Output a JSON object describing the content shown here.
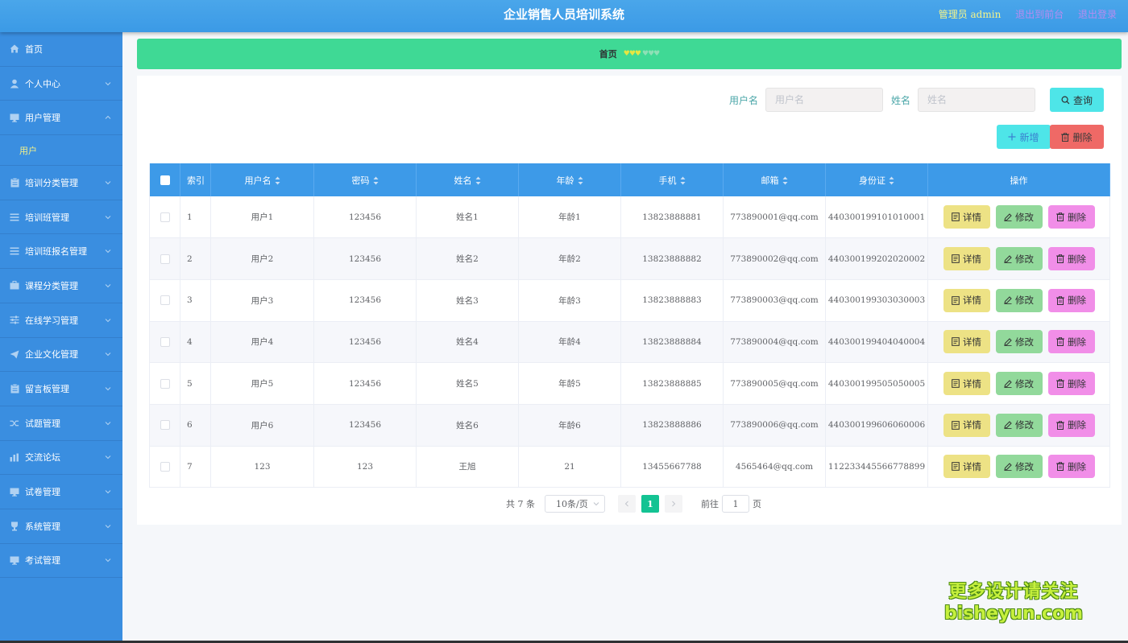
{
  "header": {
    "title": "企业销售人员培训系统",
    "admin_label": "管理员 admin",
    "front_link": "退出到前台",
    "logout_link": "退出登录"
  },
  "sidebar": {
    "items": [
      {
        "label": "首页",
        "icon": "home-icon"
      },
      {
        "label": "个人中心",
        "icon": "user-icon"
      },
      {
        "label": "用户管理",
        "icon": "monitor-icon",
        "expanded": true,
        "sub": "用户"
      },
      {
        "label": "培训分类管理",
        "icon": "clipboard-icon"
      },
      {
        "label": "培训班管理",
        "icon": "list-icon"
      },
      {
        "label": "培训班报名管理",
        "icon": "list-icon"
      },
      {
        "label": "课程分类管理",
        "icon": "briefcase-icon"
      },
      {
        "label": "在线学习管理",
        "icon": "sliders-icon"
      },
      {
        "label": "企业文化管理",
        "icon": "send-icon"
      },
      {
        "label": "留言板管理",
        "icon": "clipboard-icon"
      },
      {
        "label": "试题管理",
        "icon": "shuffle-icon"
      },
      {
        "label": "交流论坛",
        "icon": "chart-icon"
      },
      {
        "label": "试卷管理",
        "icon": "monitor-icon"
      },
      {
        "label": "系统管理",
        "icon": "trophy-icon"
      },
      {
        "label": "考试管理",
        "icon": "monitor-icon"
      }
    ]
  },
  "breadcrumb": {
    "label": "首页",
    "hearts": "♥♥♥",
    "hearts_faded": "♥♥♥"
  },
  "search": {
    "username_label": "用户名",
    "username_placeholder": "用户名",
    "name_label": "姓名",
    "name_placeholder": "姓名",
    "query_button": "查询"
  },
  "actions": {
    "add_button": "新增",
    "delete_button": "删除"
  },
  "table": {
    "headers": {
      "index": "索引",
      "username": "用户名",
      "password": "密码",
      "name": "姓名",
      "age": "年龄",
      "phone": "手机",
      "email": "邮箱",
      "idcard": "身份证",
      "ops": "操作"
    },
    "op_labels": {
      "detail": "详情",
      "edit": "修改",
      "delete": "删除"
    },
    "rows": [
      {
        "index": "1",
        "username": "用户1",
        "password": "123456",
        "name": "姓名1",
        "age": "年龄1",
        "phone": "13823888881",
        "email": "773890001@qq.com",
        "idcard": "440300199101010001"
      },
      {
        "index": "2",
        "username": "用户2",
        "password": "123456",
        "name": "姓名2",
        "age": "年龄2",
        "phone": "13823888882",
        "email": "773890002@qq.com",
        "idcard": "440300199202020002"
      },
      {
        "index": "3",
        "username": "用户3",
        "password": "123456",
        "name": "姓名3",
        "age": "年龄3",
        "phone": "13823888883",
        "email": "773890003@qq.com",
        "idcard": "440300199303030003"
      },
      {
        "index": "4",
        "username": "用户4",
        "password": "123456",
        "name": "姓名4",
        "age": "年龄4",
        "phone": "13823888884",
        "email": "773890004@qq.com",
        "idcard": "440300199404040004"
      },
      {
        "index": "5",
        "username": "用户5",
        "password": "123456",
        "name": "姓名5",
        "age": "年龄5",
        "phone": "13823888885",
        "email": "773890005@qq.com",
        "idcard": "440300199505050005"
      },
      {
        "index": "6",
        "username": "用户6",
        "password": "123456",
        "name": "姓名6",
        "age": "年龄6",
        "phone": "13823888886",
        "email": "773890006@qq.com",
        "idcard": "440300199606060006"
      },
      {
        "index": "7",
        "username": "123",
        "password": "123",
        "name": "王旭",
        "age": "21",
        "phone": "13455667788",
        "email": "4565464@qq.com",
        "idcard": "112233445566778899"
      }
    ]
  },
  "pagination": {
    "total": "共 7 条",
    "page_size": "10条/页",
    "current_page": "1",
    "goto_label": "前往",
    "goto_value": "1",
    "page_unit": "页"
  },
  "watermark": {
    "line1": "更多设计请关注",
    "line2": "bisheyun.com"
  }
}
